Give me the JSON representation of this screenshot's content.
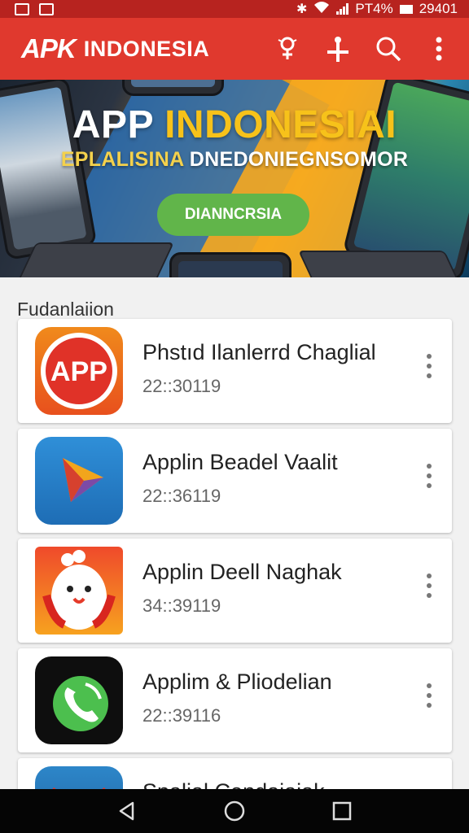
{
  "status_bar": {
    "network": "PT4%",
    "time": "29401"
  },
  "app_bar": {
    "logo": "APK",
    "title": "INDONESIA",
    "actions": [
      "pin-icon",
      "add-icon",
      "search-icon",
      "more-vert-icon"
    ]
  },
  "banner": {
    "title_part1": "APP ",
    "title_part2": "INDONESIAI",
    "subtitle_part1": "EPLALISINA ",
    "subtitle_part2": "DNEDONIEGNSOMOR",
    "button_label": "DIANNCRSIA"
  },
  "section": {
    "title": "Fudanlaiion"
  },
  "apps": [
    {
      "name": "Phstıd Ilanlerrd Chaglial",
      "meta": "22::30119",
      "icon": "app-red-icon",
      "icon_text": "APP"
    },
    {
      "name": "Applin Beadel Vaalit",
      "meta": "22::36119",
      "icon": "play-arrow-icon"
    },
    {
      "name": "Applin Deell Naghak",
      "meta": "34::39119",
      "icon": "chicken-icon"
    },
    {
      "name": "Applim & Pliodelian",
      "meta": "22::39116",
      "icon": "phone-icon"
    },
    {
      "name": "Spalial Cendaiaiak",
      "meta": "",
      "icon": "mail-icon"
    }
  ],
  "colors": {
    "status_bar": "#b7231f",
    "app_bar": "#e0392e",
    "button_green": "#61b54a",
    "nav_bar": "#050505"
  }
}
